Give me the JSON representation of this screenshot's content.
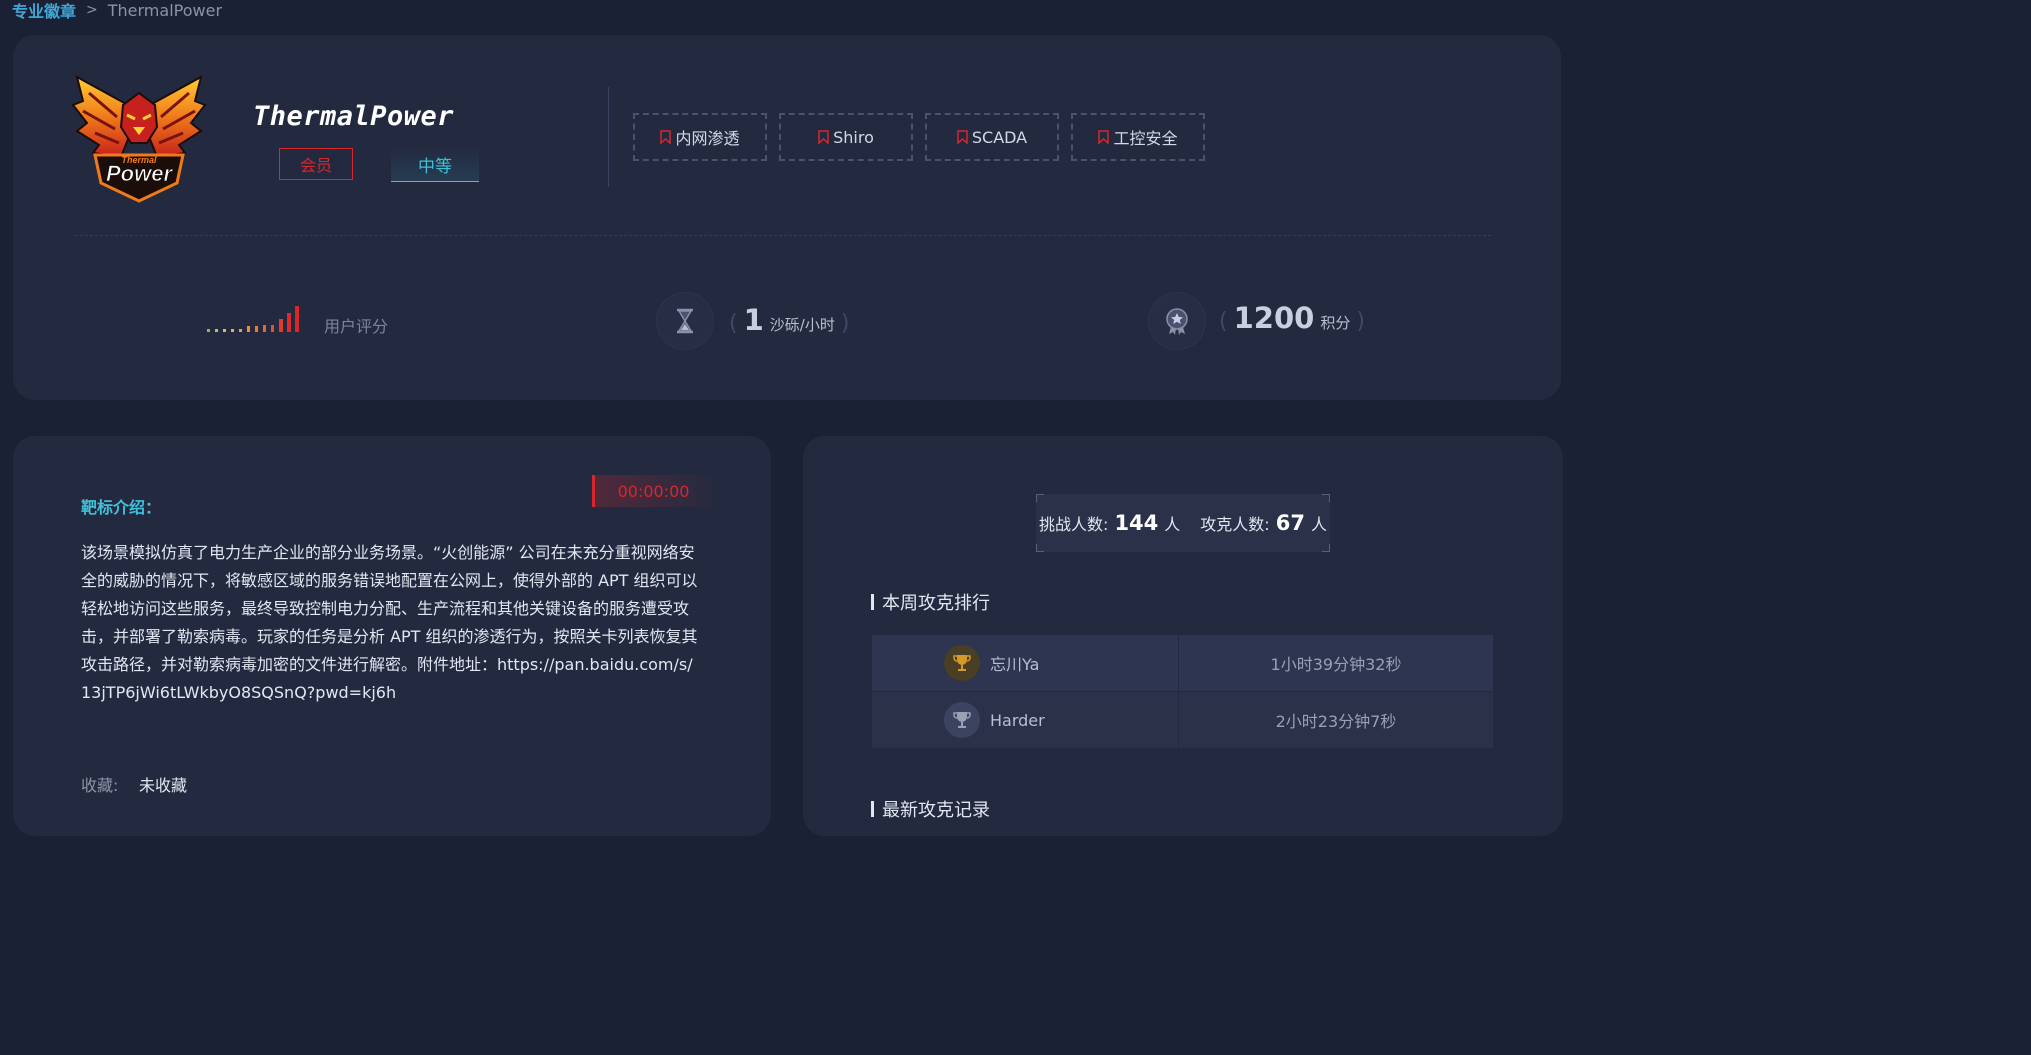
{
  "breadcrumb": {
    "parent": "专业徽章",
    "separator": ">",
    "current": "ThermalPower"
  },
  "badge": {
    "logo_text_top": "Thermal",
    "logo_text_main": "Power",
    "title": "ThermalPower",
    "member_label": "会员",
    "level_label": "中等",
    "tags": [
      "内网渗透",
      "Shiro",
      "SCADA",
      "工控安全"
    ]
  },
  "stats": {
    "rating_label": "用户评分",
    "sand_rate": {
      "open": "(",
      "value": "1",
      "unit": "沙砾/小时",
      "close": ")"
    },
    "points": {
      "open": "(",
      "value": "1200",
      "unit": "积分",
      "close": ")"
    }
  },
  "target": {
    "section_title": "靶标介绍：",
    "timer": "00:00:00",
    "description": "该场景模拟仿真了电力生产企业的部分业务场景。“火创能源” 公司在未充分重视网络安全的威胁的情况下，将敏感区域的服务错误地配置在公网上，使得外部的 APT 组织可以轻松地访问这些服务，最终导致控制电力分配、生产流程和其他关键设备的服务遭受攻击，并部署了勒索病毒。玩家的任务是分析 APT 组织的渗透行为，按照关卡列表恢复其攻击路径，并对勒索病毒加密的文件进行解密。附件地址：https://pan.baidu.com/s/13jTP6jWi6tLWkbyO8SQSnQ?pwd=kj6h",
    "favorite_label": "收藏:",
    "favorite_value": "未收藏"
  },
  "summary": {
    "challengers_label": "挑战人数:",
    "challengers_value": "144",
    "challengers_unit": "人",
    "solvers_label": "攻克人数:",
    "solvers_value": "67",
    "solvers_unit": "人"
  },
  "ranking": {
    "title": "本周攻克排行",
    "rows": [
      {
        "name": "忘川Ya",
        "time": "1小时39分钟32秒",
        "medal": "gold"
      },
      {
        "name": "Harder",
        "time": "2小时23分钟7秒",
        "medal": "silver"
      }
    ]
  },
  "latest": {
    "title": "最新攻克记录"
  },
  "colors": {
    "accent_red": "#d8262b",
    "accent_cyan": "#3ec1d8",
    "panel_bg": "#232a40",
    "page_bg": "#1b2135"
  }
}
